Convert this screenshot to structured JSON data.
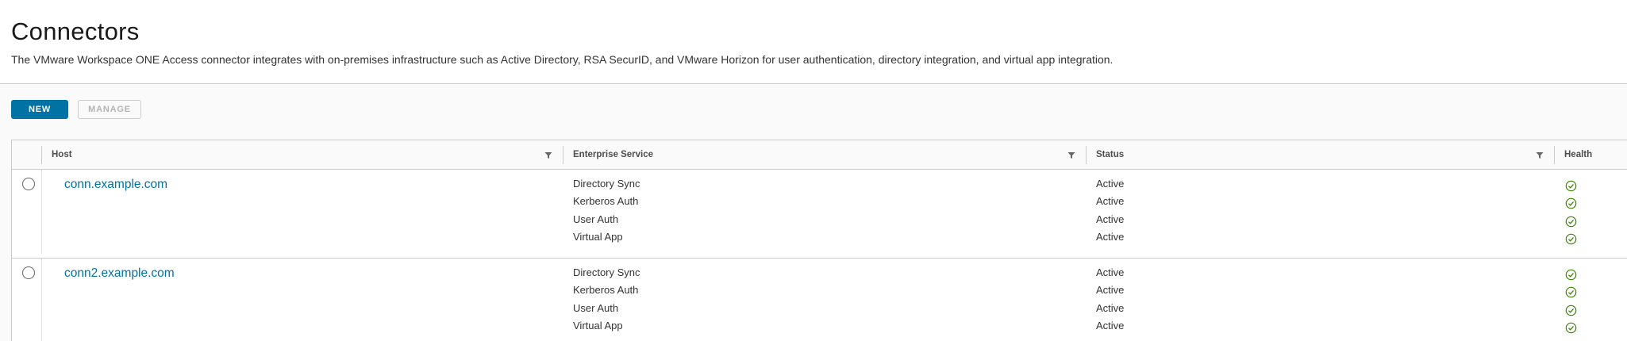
{
  "page": {
    "title": "Connectors",
    "description": "The VMware Workspace ONE Access connector integrates with on-premises infrastructure such as Active Directory, RSA SecurID, and VMware Horizon for user authentication, directory integration, and virtual app integration."
  },
  "toolbar": {
    "new_label": "NEW",
    "manage_label": "MANAGE"
  },
  "grid": {
    "columns": {
      "host": "Host",
      "service": "Enterprise Service",
      "status": "Status",
      "health": "Health"
    },
    "rows": [
      {
        "host": "conn.example.com",
        "services": [
          {
            "name": "Directory Sync",
            "status": "Active",
            "health": "check-circle-icon"
          },
          {
            "name": "Kerberos Auth",
            "status": "Active",
            "health": "check-circle-icon"
          },
          {
            "name": "User Auth",
            "status": "Active",
            "health": "check-circle-icon"
          },
          {
            "name": "Virtual App",
            "status": "Active",
            "health": "check-circle-icon"
          }
        ]
      },
      {
        "host": "conn2.example.com",
        "services": [
          {
            "name": "Directory Sync",
            "status": "Active",
            "health": "check-circle-icon"
          },
          {
            "name": "Kerberos Auth",
            "status": "Active",
            "health": "check-circle-icon"
          },
          {
            "name": "User Auth",
            "status": "Active",
            "health": "check-circle-icon"
          },
          {
            "name": "Virtual App",
            "status": "Active",
            "health": "check-circle-icon"
          }
        ]
      }
    ]
  },
  "colors": {
    "accent": "#0072a3",
    "healthy": "#3c8500"
  }
}
